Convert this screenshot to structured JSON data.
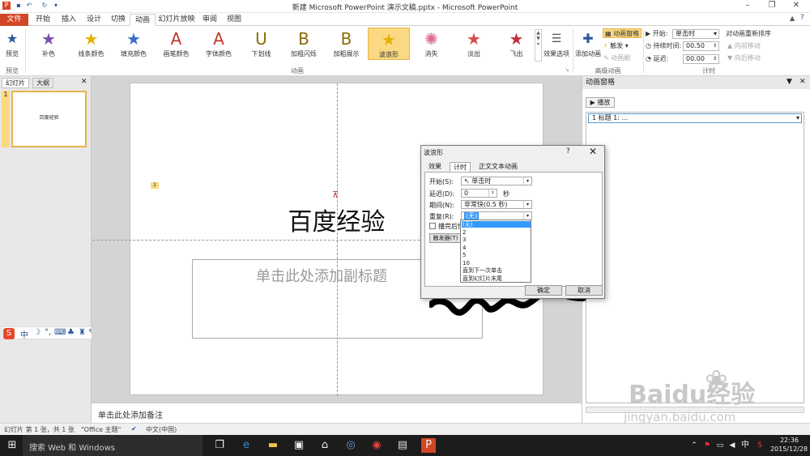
{
  "window": {
    "title": "新建 Microsoft PowerPoint 演示文稿.pptx - Microsoft PowerPoint"
  },
  "tabs": [
    "文件",
    "开始",
    "插入",
    "设计",
    "切换",
    "动画",
    "幻灯片放映",
    "审阅",
    "视图"
  ],
  "ribbon": {
    "preview_label": "预览",
    "preview_group": "预览",
    "animations": [
      {
        "label": "补色",
        "icon": "★",
        "color": "#7b52ab"
      },
      {
        "label": "线条颜色",
        "icon": "★",
        "color": "#e6b000"
      },
      {
        "label": "填充颜色",
        "icon": "★",
        "color": "#3a6fc4"
      },
      {
        "label": "画笔颜色",
        "icon": "A",
        "color": "#c0392b"
      },
      {
        "label": "字体颜色",
        "icon": "A",
        "color": "#c0392b"
      },
      {
        "label": "下划线",
        "icon": "U",
        "color": "#8a6d00"
      },
      {
        "label": "加粗闪烁",
        "icon": "B",
        "color": "#8a6d00"
      },
      {
        "label": "加粗展示",
        "icon": "B",
        "color": "#8a6d00"
      },
      {
        "label": "波浪形",
        "icon": "★",
        "color": "#e6b000"
      },
      {
        "label": "消失",
        "icon": "✺",
        "color": "#e06b8a"
      },
      {
        "label": "淡出",
        "icon": "★",
        "color": "#d64b4b"
      },
      {
        "label": "飞出",
        "icon": "★",
        "color": "#c0303a"
      }
    ],
    "effect_options": "效果选项",
    "animation_group": "动画",
    "add_animation": "添加动画",
    "anim_pane": "动画窗格",
    "trigger": "触发",
    "anim_painter": "动画刷",
    "advanced_group": "高级动画",
    "start_label": "开始:",
    "start_value": "单击时",
    "duration_label": "持续时间:",
    "duration_value": "00.50",
    "delay_label": "延迟:",
    "delay_value": "00.00",
    "reorder_label": "对动画重新排序",
    "move_earlier": "向前移动",
    "move_later": "向后移动",
    "timing_group": "计时"
  },
  "left_panel": {
    "tab_slides": "幻灯片",
    "tab_outline": "大纲",
    "slide_number": "1",
    "thumb_title": "百度经验"
  },
  "slide": {
    "title": "百度经验",
    "subtitle_placeholder": "单击此处添加副标题",
    "anim_tag": "1"
  },
  "notes": {
    "placeholder": "单击此处添加备注"
  },
  "anim_pane": {
    "title": "动画窗格",
    "play": "播放",
    "item": "1   标题 1: ..."
  },
  "dialog": {
    "title": "波浪形",
    "help": "?",
    "tabs": [
      "效果",
      "计时",
      "正文文本动画"
    ],
    "start_label": "开始(S):",
    "start_value": "单击时",
    "delay_label": "延迟(D):",
    "delay_value": "0",
    "delay_unit": "秒",
    "duration_label": "期间(N):",
    "duration_value": "非常快(0.5 秒)",
    "repeat_label": "重复(R):",
    "repeat_value": "(无)",
    "rewind_label": "播完后快",
    "trigger_btn": "触发器(T)",
    "repeat_options": [
      "(无)",
      "2",
      "3",
      "4",
      "5",
      "10",
      "直到下一次单击",
      "直到幻灯片末尾"
    ],
    "ok": "确定",
    "cancel": "取消"
  },
  "status": {
    "slide_info": "幻灯片 第 1 张，共 1 张",
    "theme": "\"Office 主题\"",
    "language": "中文(中国)"
  },
  "taskbar": {
    "search": "搜索 Web 和 Windows",
    "time": "22:36",
    "date": "2015/12/28",
    "ime": "中"
  },
  "watermark": {
    "brand": "Baidu经验",
    "url": "jingyan.baidu.com"
  }
}
